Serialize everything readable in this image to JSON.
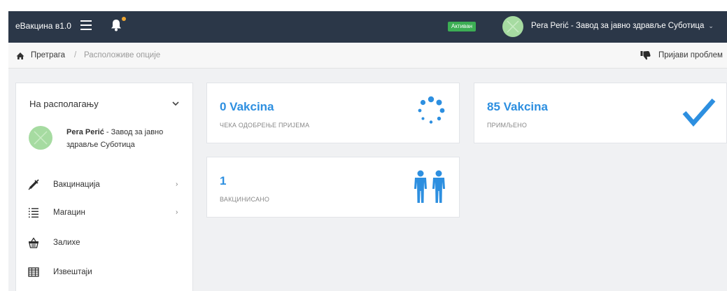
{
  "topbar": {
    "app_name": "eВакцина в1.0",
    "status_badge": "Активан",
    "user_name": "Pera Perić - Завод за јавно здравље Суботица"
  },
  "breadcrumb": {
    "home": "Претрага",
    "separator": "/",
    "current": "Расположиве опције",
    "report_link": "Пријави проблем"
  },
  "sidebar": {
    "title": "На располагању",
    "user_name": "Pera Perić",
    "user_org": " - Завод за јавно здравље Суботица",
    "items": [
      {
        "label": "Вакцинација",
        "icon": "syringe-icon",
        "has_arrow": true
      },
      {
        "label": "Магацин",
        "icon": "list-icon",
        "has_arrow": true
      },
      {
        "label": "Залихе",
        "icon": "basket-icon",
        "has_arrow": false
      },
      {
        "label": "Извештаји",
        "icon": "table-icon",
        "has_arrow": false
      }
    ]
  },
  "cards": [
    {
      "value": "0 Vakcina",
      "label": "ЧЕКА ОДОБРЕЊЕ ПРИЈЕМА",
      "icon": "spinner-icon"
    },
    {
      "value": "85 Vakcina",
      "label": "ПРИМЉЕНО",
      "icon": "checkmark-icon"
    },
    {
      "value": "1",
      "label": "ВАКЦИНИСАНО",
      "icon": "people-icon"
    }
  ],
  "colors": {
    "topbar": "#2b3748",
    "accent": "#2d8fe0",
    "status_green": "#3cae54",
    "avatar": "#a6dba1",
    "notification_dot": "#f0a732"
  }
}
